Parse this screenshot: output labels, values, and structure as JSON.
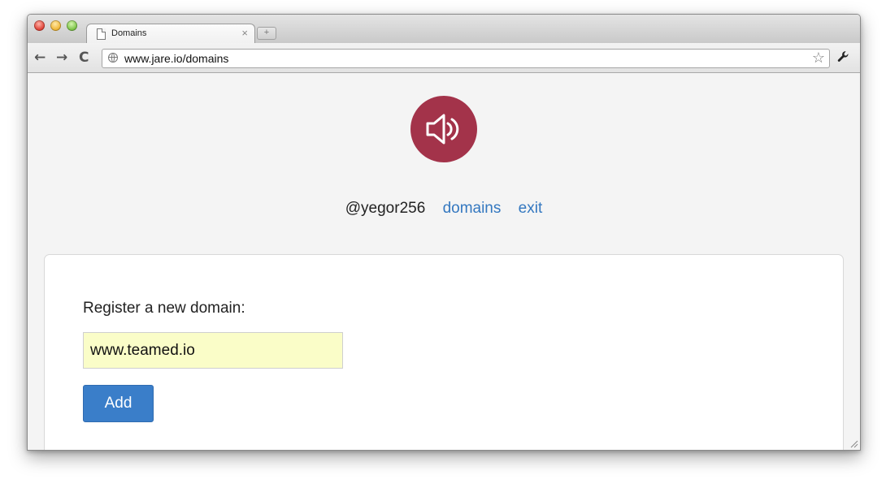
{
  "browser": {
    "tab": {
      "title": "Domains",
      "close_glyph": "×"
    },
    "new_tab_glyph": "+",
    "toolbar": {
      "back_glyph": "←",
      "forward_glyph": "→",
      "reload_glyph": "C",
      "url": "www.jare.io/domains",
      "bookmark_glyph": "☆",
      "menu_glyph": "🔧"
    }
  },
  "page": {
    "logo_icon": "speaker-icon",
    "logo_color": "#a3334a",
    "nav": {
      "handle": "@yegor256",
      "links": [
        "domains",
        "exit"
      ]
    },
    "form": {
      "label": "Register a new domain:",
      "domain_value": "www.teamed.io",
      "submit_label": "Add"
    },
    "colors": {
      "link": "#3478c0",
      "button": "#3a7ec9",
      "input_bg": "#fafdc8"
    }
  }
}
